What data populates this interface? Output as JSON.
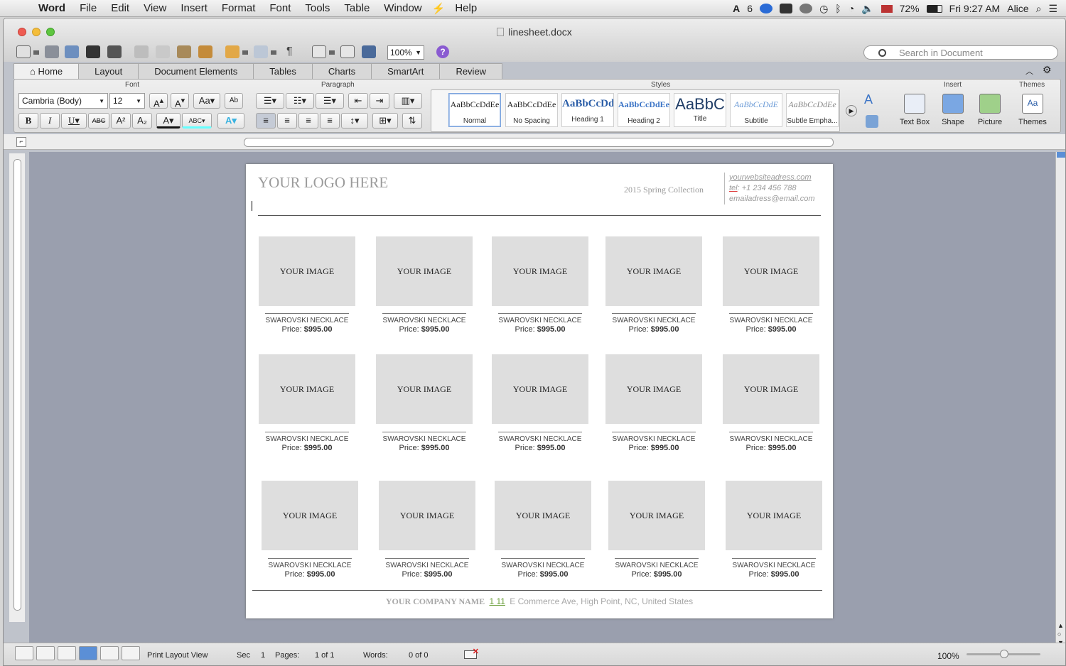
{
  "menubar": {
    "app": "Word",
    "items": [
      "File",
      "Edit",
      "View",
      "Insert",
      "Format",
      "Font",
      "Tools",
      "Table",
      "Window",
      "Help"
    ],
    "status_number": "6",
    "battery": "72%",
    "clock": "Fri 9:27 AM",
    "user": "Alice"
  },
  "window": {
    "title": "linesheet.docx",
    "zoom": "100%",
    "search_placeholder": "Search in Document"
  },
  "ribbon": {
    "tabs": [
      "Home",
      "Layout",
      "Document Elements",
      "Tables",
      "Charts",
      "SmartArt",
      "Review"
    ],
    "groups": {
      "font": "Font",
      "paragraph": "Paragraph",
      "styles": "Styles",
      "insert": "Insert",
      "themes": "Themes"
    },
    "font_name": "Cambria (Body)",
    "font_size": "12",
    "styles": [
      {
        "sample": "AaBbCcDdEe",
        "name": "Normal"
      },
      {
        "sample": "AaBbCcDdEe",
        "name": "No Spacing"
      },
      {
        "sample": "AaBbCcDd",
        "name": "Heading 1"
      },
      {
        "sample": "AaBbCcDdEe",
        "name": "Heading 2"
      },
      {
        "sample": "AaBbC",
        "name": "Title"
      },
      {
        "sample": "AaBbCcDdE",
        "name": "Subtitle"
      },
      {
        "sample": "AaBbCcDdEe",
        "name": "Subtle Empha..."
      }
    ],
    "insert": {
      "text_box": "Text Box",
      "shape": "Shape",
      "picture": "Picture"
    },
    "themes": {
      "label": "Themes",
      "icon_text": "Aa"
    }
  },
  "document": {
    "logo": "YOUR LOGO HERE",
    "collection": "2015 Spring Collection",
    "website": "yourwebsiteadress.com",
    "tel_prefix": "tel",
    "tel": ": +1 234 456 788",
    "email": "emailadress@email.com",
    "products": [
      {
        "image": "YOUR IMAGE",
        "name": "SWAROVSKI NECKLACE",
        "price_label": "Price: ",
        "price": "$995.00"
      },
      {
        "image": "YOUR IMAGE",
        "name": "SWAROVSKI NECKLACE",
        "price_label": "Price: ",
        "price": "$995.00"
      },
      {
        "image": "YOUR IMAGE",
        "name": "SWAROVSKI NECKLACE",
        "price_label": "Price: ",
        "price": "$995.00"
      },
      {
        "image": "YOUR IMAGE",
        "name": "SWAROVSKI NECKLACE",
        "price_label": "Price: ",
        "price": "$995.00"
      },
      {
        "image": "YOUR IMAGE",
        "name": "SWAROVSKI NECKLACE",
        "price_label": "Price: ",
        "price": "$995.00"
      },
      {
        "image": "YOUR IMAGE",
        "name": "SWAROVSKI NECKLACE",
        "price_label": "Price: ",
        "price": "$995.00"
      },
      {
        "image": "YOUR IMAGE",
        "name": "SWAROVSKI NECKLACE",
        "price_label": "Price: ",
        "price": "$995.00"
      },
      {
        "image": "YOUR IMAGE",
        "name": "SWAROVSKI NECKLACE",
        "price_label": "Price: ",
        "price": "$995.00"
      },
      {
        "image": "YOUR IMAGE",
        "name": "SWAROVSKI NECKLACE",
        "price_label": "Price: ",
        "price": "$995.00"
      },
      {
        "image": "YOUR IMAGE",
        "name": "SWAROVSKI NECKLACE",
        "price_label": "Price: ",
        "price": "$995.00"
      },
      {
        "image": "YOUR IMAGE",
        "name": "SWAROVSKI NECKLACE",
        "price_label": "Price: ",
        "price": "$995.00"
      },
      {
        "image": "YOUR IMAGE",
        "name": "SWAROVSKI NECKLACE",
        "price_label": "Price: ",
        "price": "$995.00"
      },
      {
        "image": "YOUR IMAGE",
        "name": "SWAROVSKI NECKLACE",
        "price_label": "Price: ",
        "price": "$995.00"
      },
      {
        "image": "YOUR IMAGE",
        "name": "SWAROVSKI NECKLACE",
        "price_label": "Price: ",
        "price": "$995.00"
      },
      {
        "image": "YOUR IMAGE",
        "name": "SWAROVSKI NECKLACE",
        "price_label": "Price: ",
        "price": "$995.00"
      }
    ],
    "footer_company": "YOUR COMPANY NAME",
    "footer_number": "1 11",
    "footer_address": "E Commerce Ave, High Point, NC, United States"
  },
  "statusbar": {
    "view": "Print Layout View",
    "sec_label": "Sec",
    "sec": "1",
    "pages_label": "Pages:",
    "pages": "1 of 1",
    "words_label": "Words:",
    "words": "0 of 0",
    "zoom": "100%"
  }
}
